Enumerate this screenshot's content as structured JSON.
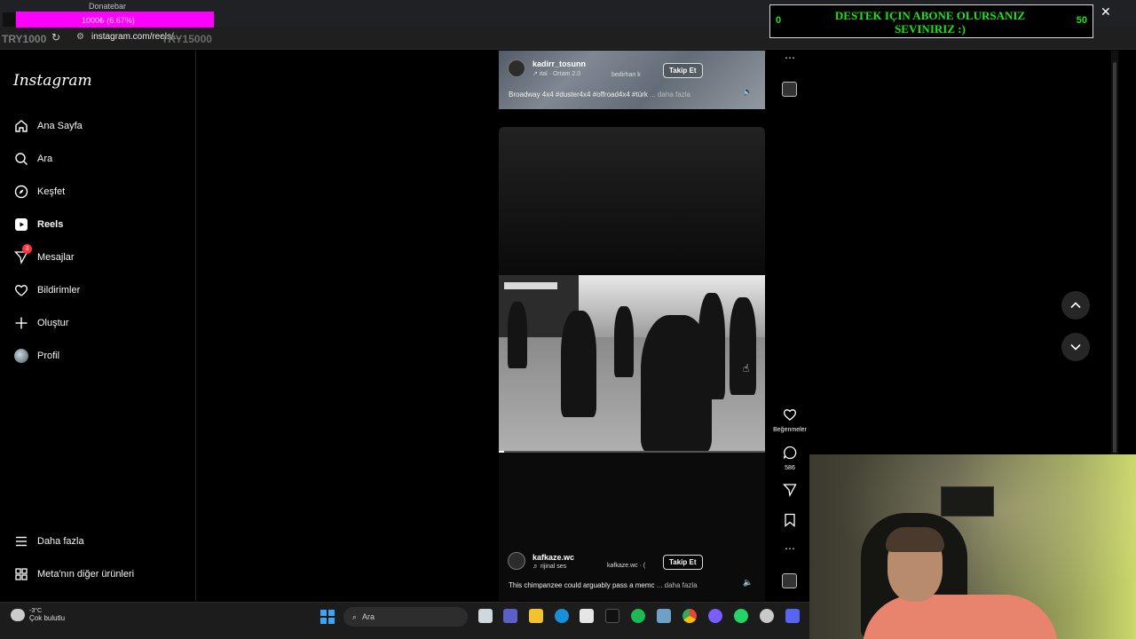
{
  "browser": {
    "url": "instagram.com/reels/...",
    "window_controls": [
      "–",
      "▢",
      "✕"
    ]
  },
  "overlay": {
    "donate_label": "Donatebar",
    "donate_progress": "1000₺ (6.67%)",
    "donate_fraction": 0.0667,
    "try_left": "TRY1000",
    "try_right": "TRY15000",
    "subscribe_text": "DESTEK IÇIN ABONE OLURSANIZ SEVINIRIZ :)",
    "sub_left": "0",
    "sub_right": "50",
    "accent": "#ff00ff",
    "sub_color": "#19e619"
  },
  "sidebar": {
    "logo": "Instagram",
    "items": [
      {
        "label": "Ana Sayfa",
        "icon": "home-icon"
      },
      {
        "label": "Ara",
        "icon": "search-icon"
      },
      {
        "label": "Keşfet",
        "icon": "compass-icon"
      },
      {
        "label": "Reels",
        "icon": "reels-icon",
        "active": true
      },
      {
        "label": "Mesajlar",
        "icon": "messenger-icon",
        "badge": "3"
      },
      {
        "label": "Bildirimler",
        "icon": "heart-icon"
      },
      {
        "label": "Oluştur",
        "icon": "plus-icon"
      },
      {
        "label": "Profil",
        "icon": "avatar"
      }
    ],
    "bottom_items": [
      {
        "label": "Daha fazla",
        "icon": "menu-icon"
      },
      {
        "label": "Meta'nın diğer ürünleri",
        "icon": "grid-icon"
      }
    ]
  },
  "reels": [
    {
      "username": "kadirr_tosunn",
      "audio": "↗ ital · Ortam 2.0",
      "collab": "bedirhan k",
      "follow": "Takip Et",
      "caption": "Broadway 4x4 #duster4x4 #offroad4x4 #türk",
      "more": "... daha fazla"
    },
    {
      "username": "kafkaze.wc",
      "audio": "♬ rijinal ses",
      "collab": "kafkaze.wc · (",
      "follow": "Takip Et",
      "caption": "This chimpanzee could arguably pass a memc",
      "more": "... daha fazla",
      "progress": 0.02
    }
  ],
  "actions": {
    "likes_label": "Beğenmeler",
    "comments_count": "586"
  },
  "taskbar": {
    "temp": "-3°C",
    "weather": "Çok bulutlu",
    "search": "Ara",
    "apps": [
      "file-icon",
      "teams-icon",
      "folder-icon",
      "edge-icon",
      "store-icon",
      "tiktok-icon",
      "spotify-icon",
      "settings-icon",
      "chrome-icon",
      "app-icon",
      "whatsapp-icon",
      "steam-icon",
      "discord-icon"
    ]
  }
}
